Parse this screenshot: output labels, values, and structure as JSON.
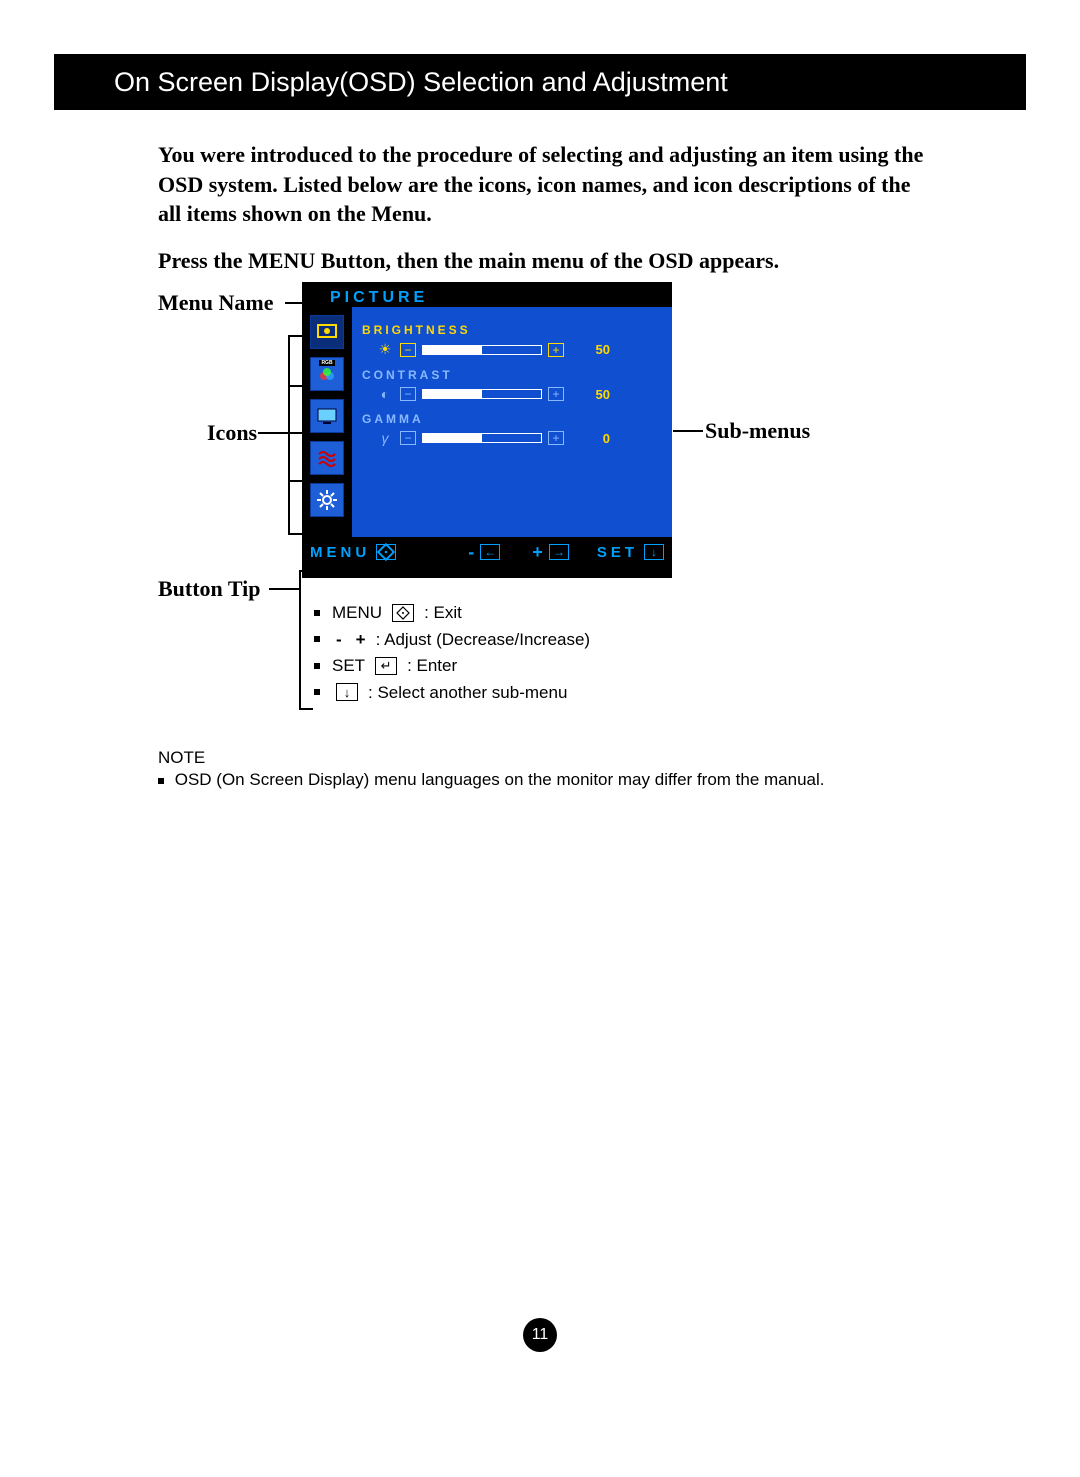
{
  "header": {
    "title": "On Screen Display(OSD) Selection and Adjustment"
  },
  "intro": "You were introduced to the procedure of selecting and adjusting an item using the OSD system.  Listed below are the icons, icon names, and icon descriptions of the all items shown on the Menu.",
  "press_menu": "Press the MENU Button, then the main menu of the OSD appears.",
  "labels": {
    "menu_name": "Menu Name",
    "icons": "Icons",
    "submenus": "Sub-menus",
    "button_tip": "Button Tip"
  },
  "osd": {
    "title": "PICTURE",
    "icons": [
      "picture",
      "rgb",
      "display",
      "waves",
      "gear"
    ],
    "submenus": [
      {
        "label": "BRIGHTNESS",
        "value": 50,
        "fill_pct": 50,
        "icon": "sun",
        "active": true
      },
      {
        "label": "CONTRAST",
        "value": 50,
        "fill_pct": 50,
        "icon": "half-circle",
        "active": false
      },
      {
        "label": "GAMMA",
        "value": 0,
        "fill_pct": 50,
        "icon": "gamma",
        "active": false
      }
    ],
    "footer": {
      "menu": "MENU",
      "minus": "-",
      "plus": "+",
      "set": "SET"
    }
  },
  "tips": {
    "t1_prefix": "MENU",
    "t1_suffix": ": Exit",
    "t2": ": Adjust (Decrease/Increase)",
    "t2_minus": "-",
    "t2_plus": "+",
    "t3_prefix": "SET",
    "t3_suffix": ": Enter",
    "t4": ": Select another sub-menu"
  },
  "note": {
    "label": "NOTE",
    "body": "OSD (On Screen Display) menu languages on the monitor may differ from the manual."
  },
  "page_number": "11"
}
